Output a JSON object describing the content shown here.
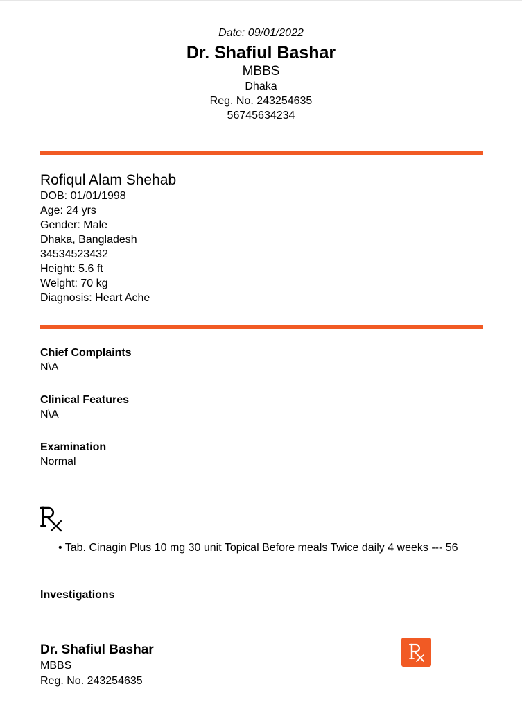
{
  "header": {
    "date": "Date: 09/01/2022",
    "doctor_name": "Dr. Shafiul Bashar",
    "degree": "MBBS",
    "location": "Dhaka",
    "reg_no": "Reg. No. 243254635",
    "phone": "56745634234"
  },
  "patient": {
    "name": "Rofiqul Alam Shehab",
    "dob": "DOB: 01/01/1998",
    "age": "Age: 24 yrs",
    "gender": "Gender: Male",
    "address": "Dhaka, Bangladesh",
    "phone": "34534523432",
    "height": "Height: 5.6 ft",
    "weight": "Weight: 70 kg",
    "diagnosis": "Diagnosis: Heart Ache"
  },
  "sections": {
    "chief_complaints": {
      "title": "Chief Complaints",
      "value": "N\\A"
    },
    "clinical_features": {
      "title": "Clinical Features",
      "value": "N\\A"
    },
    "examination": {
      "title": "Examination",
      "value": "Normal"
    }
  },
  "prescription": {
    "symbol_icon": "rx-icon",
    "items": [
      "• Tab. Cinagin Plus 10 mg 30 unit Topical Before meals Twice daily 4 weeks --- 56"
    ]
  },
  "investigations": {
    "title": "Investigations"
  },
  "footer": {
    "doctor_name": "Dr. Shafiul Bashar",
    "degree": "MBBS",
    "reg_no": "Reg. No. 243254635",
    "badge_icon": "rx-badge-icon"
  },
  "colors": {
    "accent": "#f15a24"
  }
}
